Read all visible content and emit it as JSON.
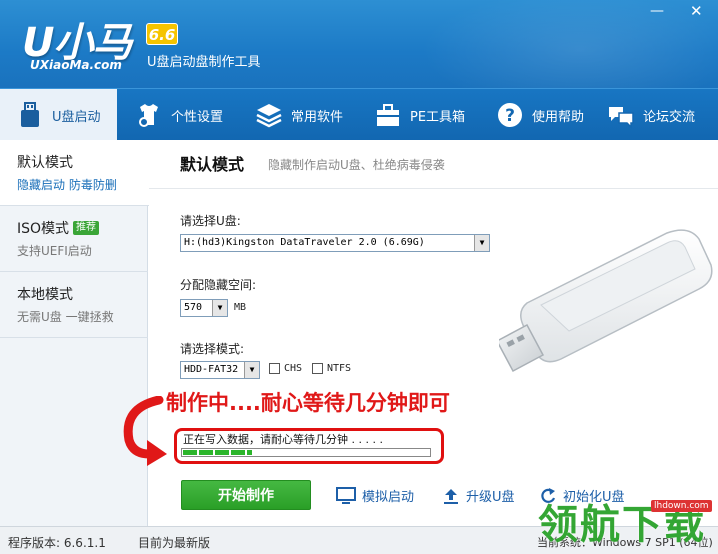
{
  "app": {
    "logo": "U小马",
    "version_badge": "6.6",
    "site": "UXiaoMa.com",
    "subtitle": "U盘启动盘制作工具",
    "min_glyph": "—",
    "close_glyph": "✕"
  },
  "nav": {
    "items": [
      {
        "label": "U盘启动",
        "icon": "usb-drive-icon"
      },
      {
        "label": "个性设置",
        "icon": "shirt-gear-icon"
      },
      {
        "label": "常用软件",
        "icon": "layers-icon"
      },
      {
        "label": "PE工具箱",
        "icon": "toolbox-icon"
      },
      {
        "label": "使用帮助",
        "icon": "help-icon"
      },
      {
        "label": "论坛交流",
        "icon": "chat-bubbles-icon"
      }
    ],
    "active": "U盘启动"
  },
  "sidebar": {
    "items": [
      {
        "title": "默认模式",
        "desc": "隐藏启动 防毒防删"
      },
      {
        "title": "ISO模式",
        "badge": "推荐",
        "desc": "支持UEFI启动"
      },
      {
        "title": "本地模式",
        "desc": "无需U盘 一键拯救"
      }
    ],
    "active": "默认模式"
  },
  "main": {
    "title": "默认模式",
    "desc": "隐藏制作启动U盘、杜绝病毒侵袭",
    "disk_label": "请选择U盘:",
    "disk_value": "H:(hd3)Kingston DataTraveler 2.0 (6.69G)",
    "hidden_label": "分配隐藏空间:",
    "hidden_value": "570",
    "hidden_unit": "MB",
    "mode_label": "请选择模式:",
    "mode_value": "HDD-FAT32",
    "chs_label": "CHS",
    "ntfs_label": "NTFS",
    "annotation": "制作中....耐心等待几分钟即可",
    "progress_text": "正在写入数据，请耐心等待几分钟 . . . . .",
    "progress": 0.28,
    "start_label": "开始制作",
    "simulate_label": "模拟启动",
    "upgrade_label": "升级U盘",
    "init_label": "初始化U盘"
  },
  "footer": {
    "version": "程序版本: 6.6.1.1",
    "latest": "目前为最新版",
    "sysinfo": "当前系统：Windows 7 SP1 (64位)"
  },
  "watermark": {
    "text": "领航下载",
    "url": "lhdown.com"
  },
  "colors": {
    "brand_blue": "#1c7ac6",
    "start_green": "#2a9f27",
    "annotation_red": "#e01818"
  }
}
